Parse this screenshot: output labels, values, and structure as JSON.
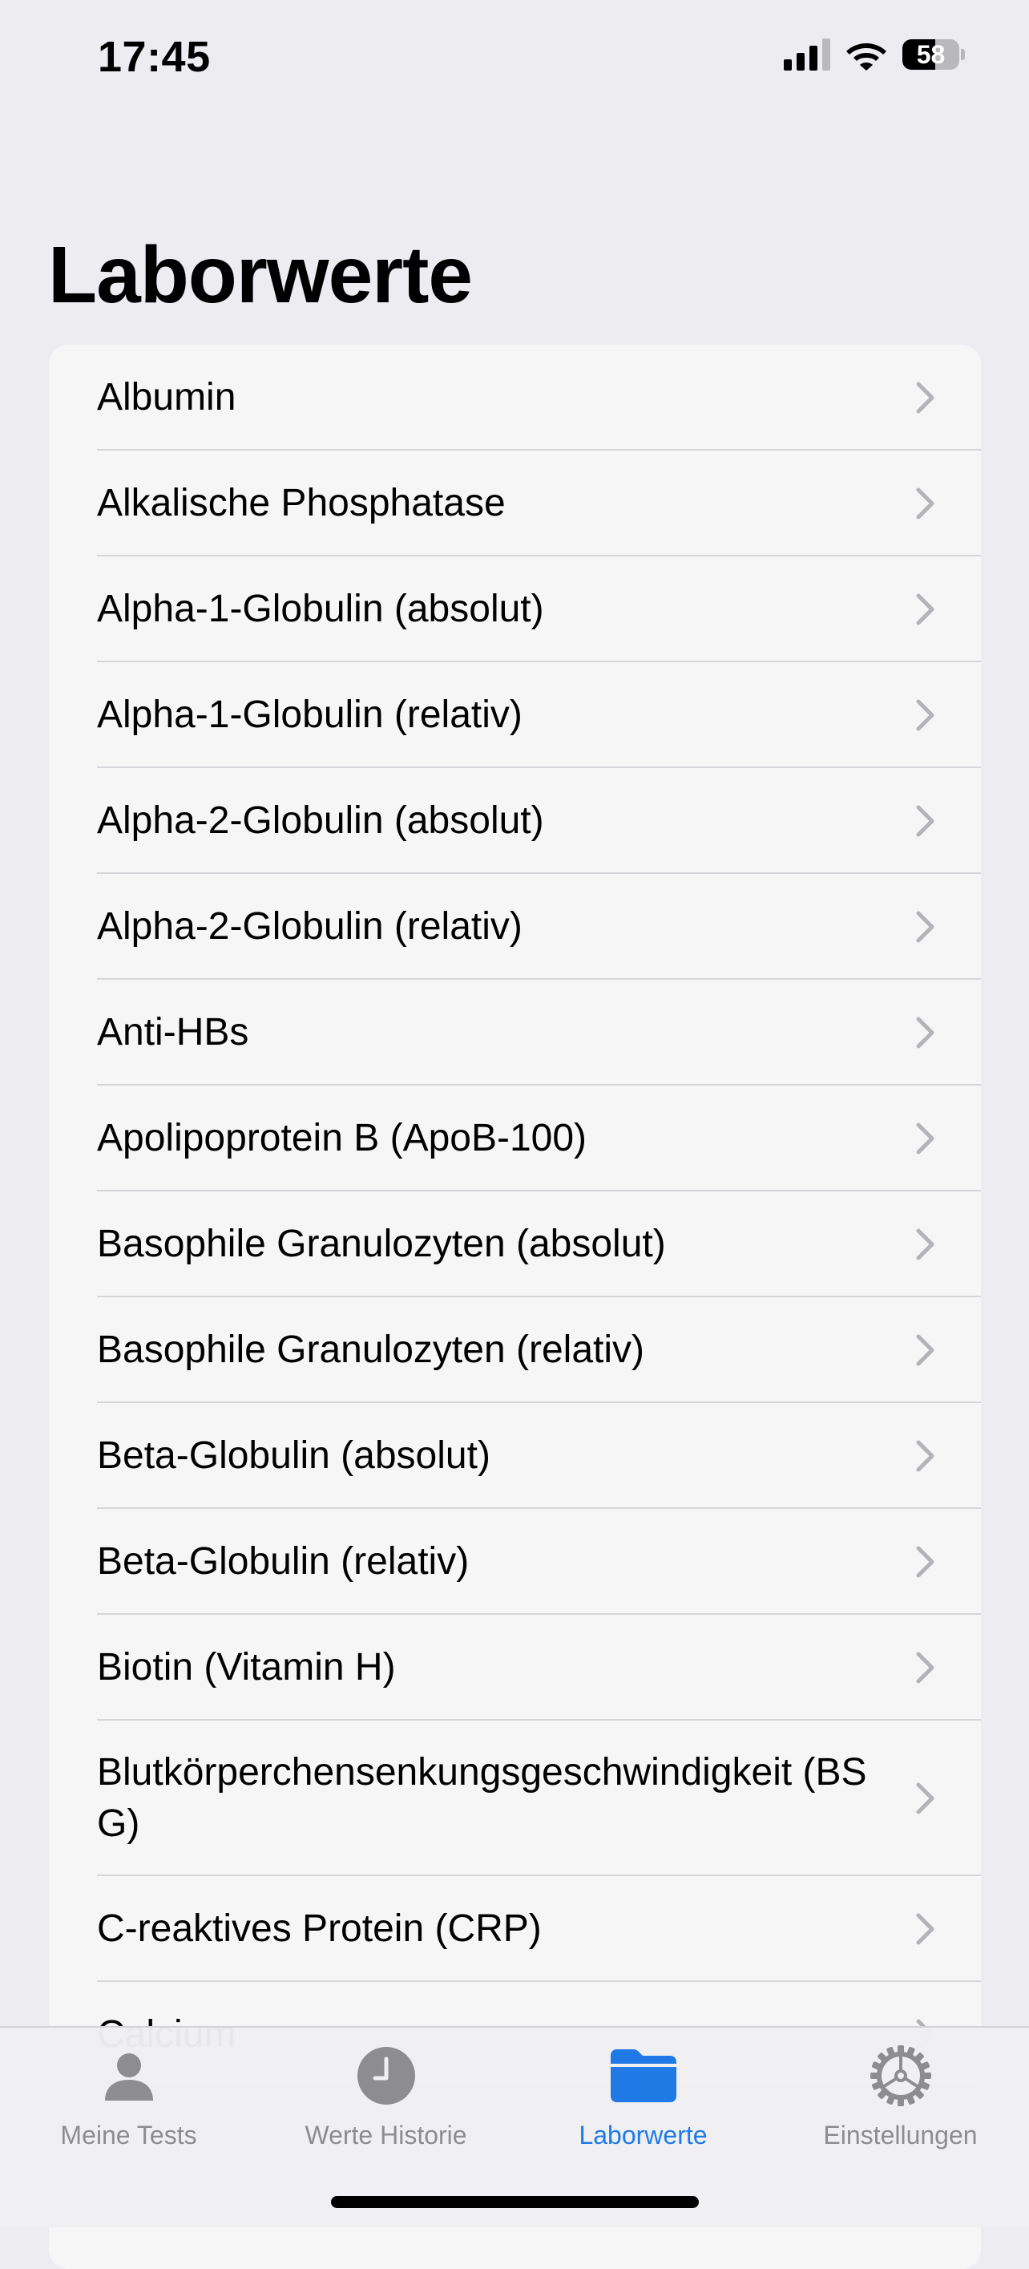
{
  "status_bar": {
    "time": "17:45",
    "battery": "58",
    "battery_level": 0.58,
    "icons": [
      "cellular-signal-icon",
      "wifi-icon",
      "battery-icon"
    ]
  },
  "page": {
    "title": "Laborwerte"
  },
  "list": {
    "items": [
      {
        "label": "Albumin"
      },
      {
        "label": "Alkalische Phosphatase"
      },
      {
        "label": "Alpha-1-Globulin (absolut)"
      },
      {
        "label": "Alpha-1-Globulin (relativ)"
      },
      {
        "label": "Alpha-2-Globulin (absolut)"
      },
      {
        "label": "Alpha-2-Globulin (relativ)"
      },
      {
        "label": "Anti-HBs"
      },
      {
        "label": "Apolipoprotein B (ApoB-100)"
      },
      {
        "label": "Basophile Granulozyten (absolut)"
      },
      {
        "label": "Basophile Granulozyten (relativ)"
      },
      {
        "label": "Beta-Globulin (absolut)"
      },
      {
        "label": "Beta-Globulin (relativ)"
      },
      {
        "label": "Biotin (Vitamin H)"
      },
      {
        "label": "Blutkörperchensenkungsgeschwindigkeit (BSG)"
      },
      {
        "label": "C-reaktives Protein (CRP)"
      },
      {
        "label": "Calcium"
      }
    ]
  },
  "tab_bar": {
    "tabs": [
      {
        "label": "Meine Tests",
        "icon": "person-icon",
        "active": false
      },
      {
        "label": "Werte Historie",
        "icon": "clock-icon",
        "active": false
      },
      {
        "label": "Laborwerte",
        "icon": "folder-icon",
        "active": true
      },
      {
        "label": "Einstellungen",
        "icon": "gear-icon",
        "active": false
      }
    ]
  },
  "colors": {
    "accent": "#1f7ae6",
    "inactive_tab": "#8d8d91",
    "background": "#ececf1",
    "card": "#f6f6f6",
    "chevron": "#b4b4b8"
  }
}
